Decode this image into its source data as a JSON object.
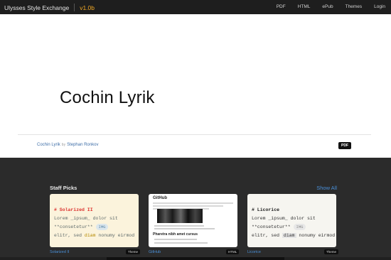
{
  "header": {
    "brand": "Ulysses Style Exchange",
    "version": "v1.0b",
    "nav": [
      "PDF",
      "HTML",
      "ePub",
      "Themes",
      "Login"
    ]
  },
  "hero": {
    "title": "Cochin Lyrik"
  },
  "credit": {
    "style_name": "Cochin Lyrik",
    "by": "by",
    "author": "Stephan Ronkov",
    "format_badge": "PDF"
  },
  "picks": {
    "title": "Staff Picks",
    "show_all": "Show All",
    "cards": [
      {
        "name": "Solarized II",
        "format": "Theme",
        "code": {
          "heading": "# Solarized II",
          "line1": "Lorem _ipsum_ dolor sit",
          "line2_text": "**consetetur**",
          "line2_pill": "IMG",
          "line3_pre": "elitr, sed ",
          "line3_hl": "diam",
          "line3_post": " nonumy eirmod"
        }
      },
      {
        "name": "GitHub",
        "format": "HTML",
        "preview": {
          "title": "GitHub",
          "heading": "Pharetra nibh amet cursus"
        }
      },
      {
        "name": "Licorice",
        "format": "Theme",
        "code": {
          "heading": "# Licorice",
          "line1": "Lorem _ipsum_ dolor sit",
          "line2_text": "**consetetur**",
          "line2_pill": "IMG",
          "line3_pre": "elitr, sed ",
          "line3_hl": "diam",
          "line3_post": " nonumy eirmod"
        }
      }
    ]
  },
  "colors": {
    "accent_orange": "#f0a825",
    "link_blue": "#4a90d9",
    "header_bg": "#1e1e1e",
    "section_bg": "#2b2b2b"
  }
}
